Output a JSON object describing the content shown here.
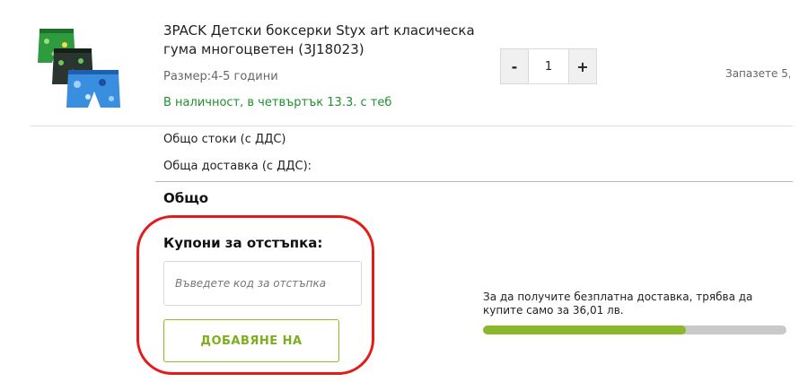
{
  "product": {
    "title": "3PACK Детски боксерки Styx art класическа гума многоцветен (3J18023)",
    "size": "Размер:4-5 години",
    "stock": "В наличност, в четвъртък 13.3. с теб",
    "quantity": "1",
    "qty_minus": "-",
    "qty_plus": "+",
    "save_text": "Запазете 5,"
  },
  "summary": {
    "goods_label": "Общо стоки (с ДДС)",
    "delivery_label": "Обща доставка (с ДДС):",
    "total_label": "Общо"
  },
  "coupon": {
    "title": "Купони за отстъпка:",
    "placeholder": "Въведете код за отстъпка",
    "button_label": "ДОБАВЯНЕ НА"
  },
  "shipping": {
    "message": "За да получите безплатна доставка, трябва да купите само за 36,01 лв.",
    "progress": 0.67,
    "bar_color": "#8ab82a"
  },
  "colors": {
    "accent": "#7cae1d",
    "stock": "#1f8f2d",
    "highlight": "#e41b1b"
  }
}
